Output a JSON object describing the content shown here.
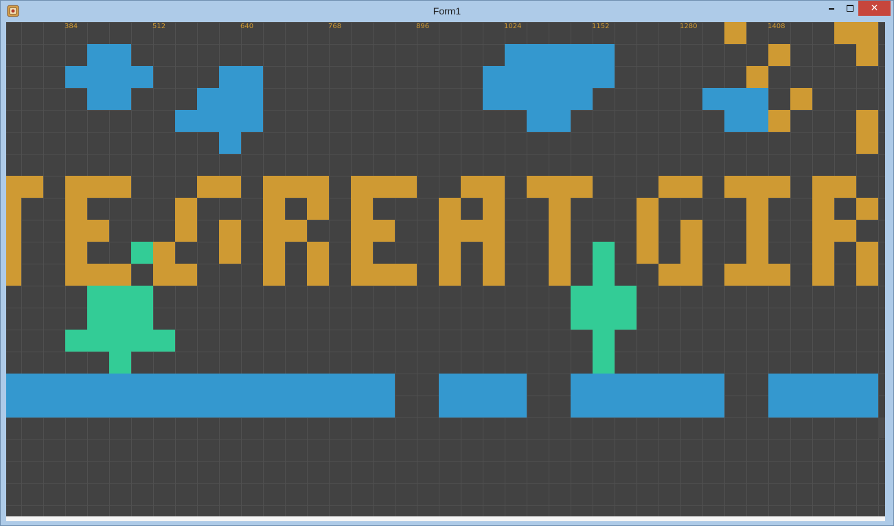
{
  "window": {
    "title": "Form1",
    "close_glyph": "✕"
  },
  "colors": {
    "background": "#424242",
    "grid_line": "#505050",
    "water_cloud": "#3498cf",
    "gold_block": "#cf9a33",
    "tree": "#33cc96",
    "coordinate_label": "#cf9a33"
  },
  "icons": {
    "app": "app-icon",
    "minimize": "minimize-icon",
    "maximize": "maximize-icon",
    "close": "close-icon"
  },
  "scene": {
    "column_labels": [
      "384",
      "512",
      "640",
      "768",
      "896",
      "1024",
      "1152",
      "1280",
      "1408"
    ],
    "cell_map": [
      "~~~~~~~~~~~~~~~~~~~~~~~~~~~~~~~~~G~~~~GG",
      "~~~~BB~~~~~~~~~~~~~~~~~BBBBB~~~~~~~G~~~G",
      "~~~BBBB~~~BB~~~~~~~~~~BBBBBB~~~~~~G~~~~~",
      "~~~~BB~~~BBB~~~~~~~~~~BBBBB~~~~~BBB~G~~~",
      "~~~~~~~~BBBB~~~~~~~~~~~~BB~~~~~~~BBG~~~G",
      "~~~~~~~~~~B~~~~~~~~~~~~~~~~~~~~~~~~~~~~G",
      "~~~~~~~~~~~~~~~~~~~~~~~~~~~~~~~~~~~~~~~~",
      "GG~GGG~~~GG~GGG~GGG~~GG~GGG~~~GG~GGG~GG~",
      "G~~G~~~~G~~~G~G~G~~~G~G~~G~~~G~~~~G~~G~G",
      "G~~GG~~~G~G~GG~~GG~~GGG~~G~~~G~G~~G~~GG~",
      "G~~G~~TG~~G~G~G~G~~~G~G~~G~T~G~G~~G~~G~G",
      "G~~GGG~GG~~~G~G~GGG~G~G~~G~T~~GG~GGG~G~G",
      "~~~~TTT~~~~~~~~~~~~~~~~~~~TTT~~~~~~~~~~~",
      "~~~~TTT~~~~~~~~~~~~~~~~~~~TTT~~~~~~~~~~~",
      "~~~TTTTT~~~~~~~~~~~~~~~~~~~T~~~~~~~~~~~~",
      "~~~~~T~~~~~~~~~~~~~~~~~~~~~T~~~~~~~~~~~~",
      "BBBBBBBBBBBBBBBBBB~~BBBB~~BBBBBBB~~BBBBB",
      "BBBBBBBBBBBBBBBBBB~~BBBB~~BBBBBBB~~BBBBB",
      "~~~~~~~~~~~~~~~~~~~~~~~~~~~~~~~~~~~~~~~~",
      "~~~~~~~~~~~~~~~~~~~~~~~~~~~~~~~~~~~~~~~~",
      "~~~~~~~~~~~~~~~~~~~~~~~~~~~~~~~~~~~~~~~~",
      "~~~~~~~~~~~~~~~~~~~~~~~~~~~~~~~~~~~~~~~~",
      "~~~~~~~~~~~~~~~~~~~~~~~~~~~~~~~~~~~~~~~~"
    ]
  }
}
